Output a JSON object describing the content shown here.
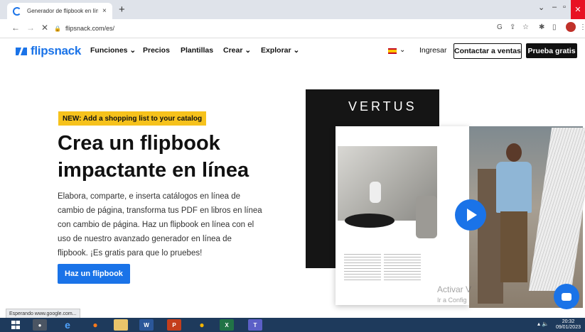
{
  "browser": {
    "tab_title": "Generador de flipbook en línea",
    "tab_close": "×",
    "new_tab": "+",
    "url": "flipsnack.com/es/",
    "status": "Esperando www.google.com..."
  },
  "site": {
    "logo": "flipsnack",
    "nav": [
      "Funciones ⌄",
      "Precios",
      "Plantillas",
      "Crear ⌄",
      "Explorar ⌄"
    ],
    "language_chevron": "⌄",
    "login": "Ingresar",
    "contact_sales": "Contactar a ventas",
    "free_trial": "Prueba gratis"
  },
  "hero": {
    "badge": "NEW: Add a shopping list to your catalog",
    "title": "Crea un flipbook impactante en línea",
    "description": "Elabora, comparte, e inserta catálogos en línea de cambio de página, transforma tus PDF en libros en línea con cambio de página. Haz un flipbook en línea con el uso de nuestro avanzado generador en línea de flipbook. ¡Es gratis para que lo pruebes!",
    "cta": "Haz un flipbook"
  },
  "illustration": {
    "brand": "VERTUS"
  },
  "watermark": {
    "line1": "Activar V",
    "line2": "Ir a Config"
  },
  "taskbar": {
    "apps": [
      "W",
      "P",
      "X",
      "T"
    ],
    "clock_time": "20:32",
    "clock_date": "09/01/2023"
  },
  "colors": {
    "accent": "#1a73e8",
    "badge": "#f6c21c"
  }
}
